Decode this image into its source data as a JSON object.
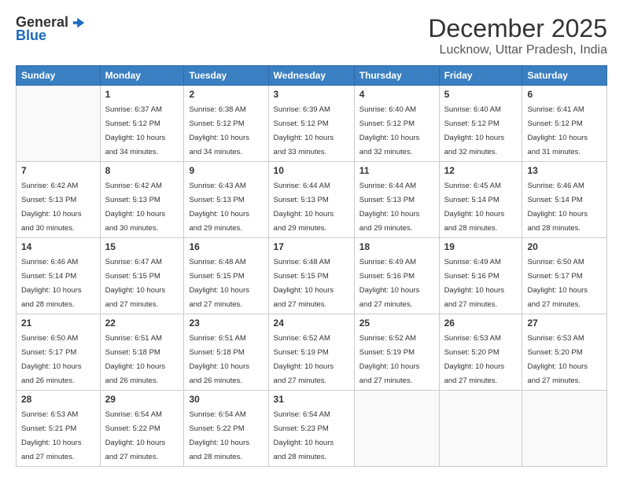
{
  "header": {
    "logo_general": "General",
    "logo_blue": "Blue",
    "month_title": "December 2025",
    "location": "Lucknow, Uttar Pradesh, India"
  },
  "days_of_week": [
    "Sunday",
    "Monday",
    "Tuesday",
    "Wednesday",
    "Thursday",
    "Friday",
    "Saturday"
  ],
  "weeks": [
    [
      {
        "day": "",
        "info": ""
      },
      {
        "day": "1",
        "info": "Sunrise: 6:37 AM\nSunset: 5:12 PM\nDaylight: 10 hours\nand 34 minutes."
      },
      {
        "day": "2",
        "info": "Sunrise: 6:38 AM\nSunset: 5:12 PM\nDaylight: 10 hours\nand 34 minutes."
      },
      {
        "day": "3",
        "info": "Sunrise: 6:39 AM\nSunset: 5:12 PM\nDaylight: 10 hours\nand 33 minutes."
      },
      {
        "day": "4",
        "info": "Sunrise: 6:40 AM\nSunset: 5:12 PM\nDaylight: 10 hours\nand 32 minutes."
      },
      {
        "day": "5",
        "info": "Sunrise: 6:40 AM\nSunset: 5:12 PM\nDaylight: 10 hours\nand 32 minutes."
      },
      {
        "day": "6",
        "info": "Sunrise: 6:41 AM\nSunset: 5:12 PM\nDaylight: 10 hours\nand 31 minutes."
      }
    ],
    [
      {
        "day": "7",
        "info": "Sunrise: 6:42 AM\nSunset: 5:13 PM\nDaylight: 10 hours\nand 30 minutes."
      },
      {
        "day": "8",
        "info": "Sunrise: 6:42 AM\nSunset: 5:13 PM\nDaylight: 10 hours\nand 30 minutes."
      },
      {
        "day": "9",
        "info": "Sunrise: 6:43 AM\nSunset: 5:13 PM\nDaylight: 10 hours\nand 29 minutes."
      },
      {
        "day": "10",
        "info": "Sunrise: 6:44 AM\nSunset: 5:13 PM\nDaylight: 10 hours\nand 29 minutes."
      },
      {
        "day": "11",
        "info": "Sunrise: 6:44 AM\nSunset: 5:13 PM\nDaylight: 10 hours\nand 29 minutes."
      },
      {
        "day": "12",
        "info": "Sunrise: 6:45 AM\nSunset: 5:14 PM\nDaylight: 10 hours\nand 28 minutes."
      },
      {
        "day": "13",
        "info": "Sunrise: 6:46 AM\nSunset: 5:14 PM\nDaylight: 10 hours\nand 28 minutes."
      }
    ],
    [
      {
        "day": "14",
        "info": "Sunrise: 6:46 AM\nSunset: 5:14 PM\nDaylight: 10 hours\nand 28 minutes."
      },
      {
        "day": "15",
        "info": "Sunrise: 6:47 AM\nSunset: 5:15 PM\nDaylight: 10 hours\nand 27 minutes."
      },
      {
        "day": "16",
        "info": "Sunrise: 6:48 AM\nSunset: 5:15 PM\nDaylight: 10 hours\nand 27 minutes."
      },
      {
        "day": "17",
        "info": "Sunrise: 6:48 AM\nSunset: 5:15 PM\nDaylight: 10 hours\nand 27 minutes."
      },
      {
        "day": "18",
        "info": "Sunrise: 6:49 AM\nSunset: 5:16 PM\nDaylight: 10 hours\nand 27 minutes."
      },
      {
        "day": "19",
        "info": "Sunrise: 6:49 AM\nSunset: 5:16 PM\nDaylight: 10 hours\nand 27 minutes."
      },
      {
        "day": "20",
        "info": "Sunrise: 6:50 AM\nSunset: 5:17 PM\nDaylight: 10 hours\nand 27 minutes."
      }
    ],
    [
      {
        "day": "21",
        "info": "Sunrise: 6:50 AM\nSunset: 5:17 PM\nDaylight: 10 hours\nand 26 minutes."
      },
      {
        "day": "22",
        "info": "Sunrise: 6:51 AM\nSunset: 5:18 PM\nDaylight: 10 hours\nand 26 minutes."
      },
      {
        "day": "23",
        "info": "Sunrise: 6:51 AM\nSunset: 5:18 PM\nDaylight: 10 hours\nand 26 minutes."
      },
      {
        "day": "24",
        "info": "Sunrise: 6:52 AM\nSunset: 5:19 PM\nDaylight: 10 hours\nand 27 minutes."
      },
      {
        "day": "25",
        "info": "Sunrise: 6:52 AM\nSunset: 5:19 PM\nDaylight: 10 hours\nand 27 minutes."
      },
      {
        "day": "26",
        "info": "Sunrise: 6:53 AM\nSunset: 5:20 PM\nDaylight: 10 hours\nand 27 minutes."
      },
      {
        "day": "27",
        "info": "Sunrise: 6:53 AM\nSunset: 5:20 PM\nDaylight: 10 hours\nand 27 minutes."
      }
    ],
    [
      {
        "day": "28",
        "info": "Sunrise: 6:53 AM\nSunset: 5:21 PM\nDaylight: 10 hours\nand 27 minutes."
      },
      {
        "day": "29",
        "info": "Sunrise: 6:54 AM\nSunset: 5:22 PM\nDaylight: 10 hours\nand 27 minutes."
      },
      {
        "day": "30",
        "info": "Sunrise: 6:54 AM\nSunset: 5:22 PM\nDaylight: 10 hours\nand 28 minutes."
      },
      {
        "day": "31",
        "info": "Sunrise: 6:54 AM\nSunset: 5:23 PM\nDaylight: 10 hours\nand 28 minutes."
      },
      {
        "day": "",
        "info": ""
      },
      {
        "day": "",
        "info": ""
      },
      {
        "day": "",
        "info": ""
      }
    ]
  ]
}
